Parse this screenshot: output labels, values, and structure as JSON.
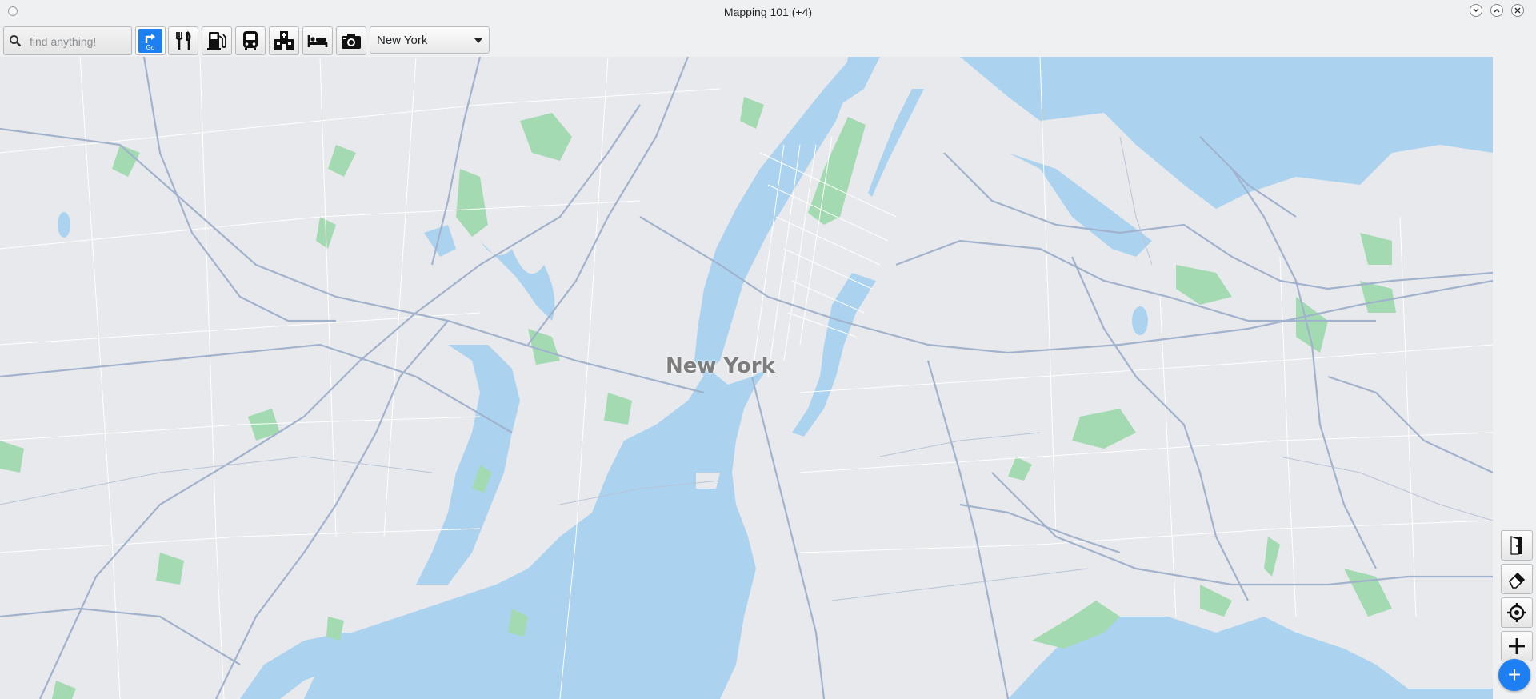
{
  "window": {
    "title": "Mapping 101 (+4)",
    "controls": [
      "minimize",
      "maximize",
      "close"
    ]
  },
  "toolbar": {
    "search_placeholder": "find anything!",
    "go_label": "Go",
    "buttons": [
      {
        "name": "go-directions-button",
        "icon": "directions-icon"
      },
      {
        "name": "restaurants-button",
        "icon": "fork-knife-icon"
      },
      {
        "name": "fuel-button",
        "icon": "fuel-pump-icon"
      },
      {
        "name": "transit-button",
        "icon": "bus-icon"
      },
      {
        "name": "hospital-button",
        "icon": "hospital-icon"
      },
      {
        "name": "lodging-button",
        "icon": "bed-icon"
      },
      {
        "name": "photo-button",
        "icon": "camera-icon"
      }
    ],
    "location_select": {
      "value": "New York",
      "options": [
        "New York"
      ]
    }
  },
  "map": {
    "city_label": "New York",
    "colors": {
      "land": "#e8e9ed",
      "water": "#abd3f0",
      "park": "#a3dab1",
      "road": "#a1b2cc",
      "minor_road": "#ffffff"
    }
  },
  "side_controls": [
    {
      "name": "exit-button",
      "icon": "door-exit-icon"
    },
    {
      "name": "eraser-button",
      "icon": "eraser-icon"
    },
    {
      "name": "locate-button",
      "icon": "crosshair-icon"
    },
    {
      "name": "zoom-in-button",
      "icon": "plus-icon"
    }
  ],
  "fab": {
    "label": "+",
    "icon": "add-icon"
  }
}
